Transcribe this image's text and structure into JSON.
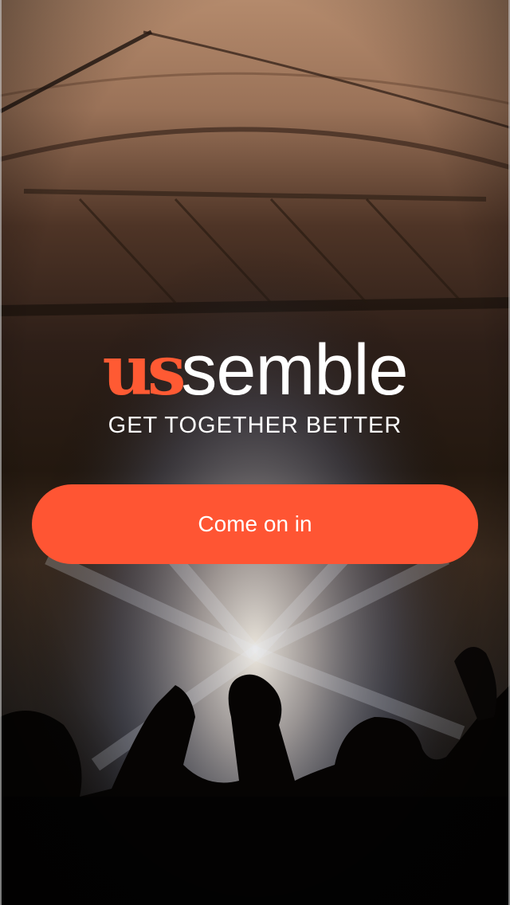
{
  "brand": {
    "logo_part1": "us",
    "logo_part2": "semble",
    "tagline": "GET TOGETHER BETTER",
    "accent_color": "#ff5533"
  },
  "actions": {
    "enter_label": "Come on in"
  },
  "background": {
    "description_icon": "concert-crowd-photo"
  }
}
